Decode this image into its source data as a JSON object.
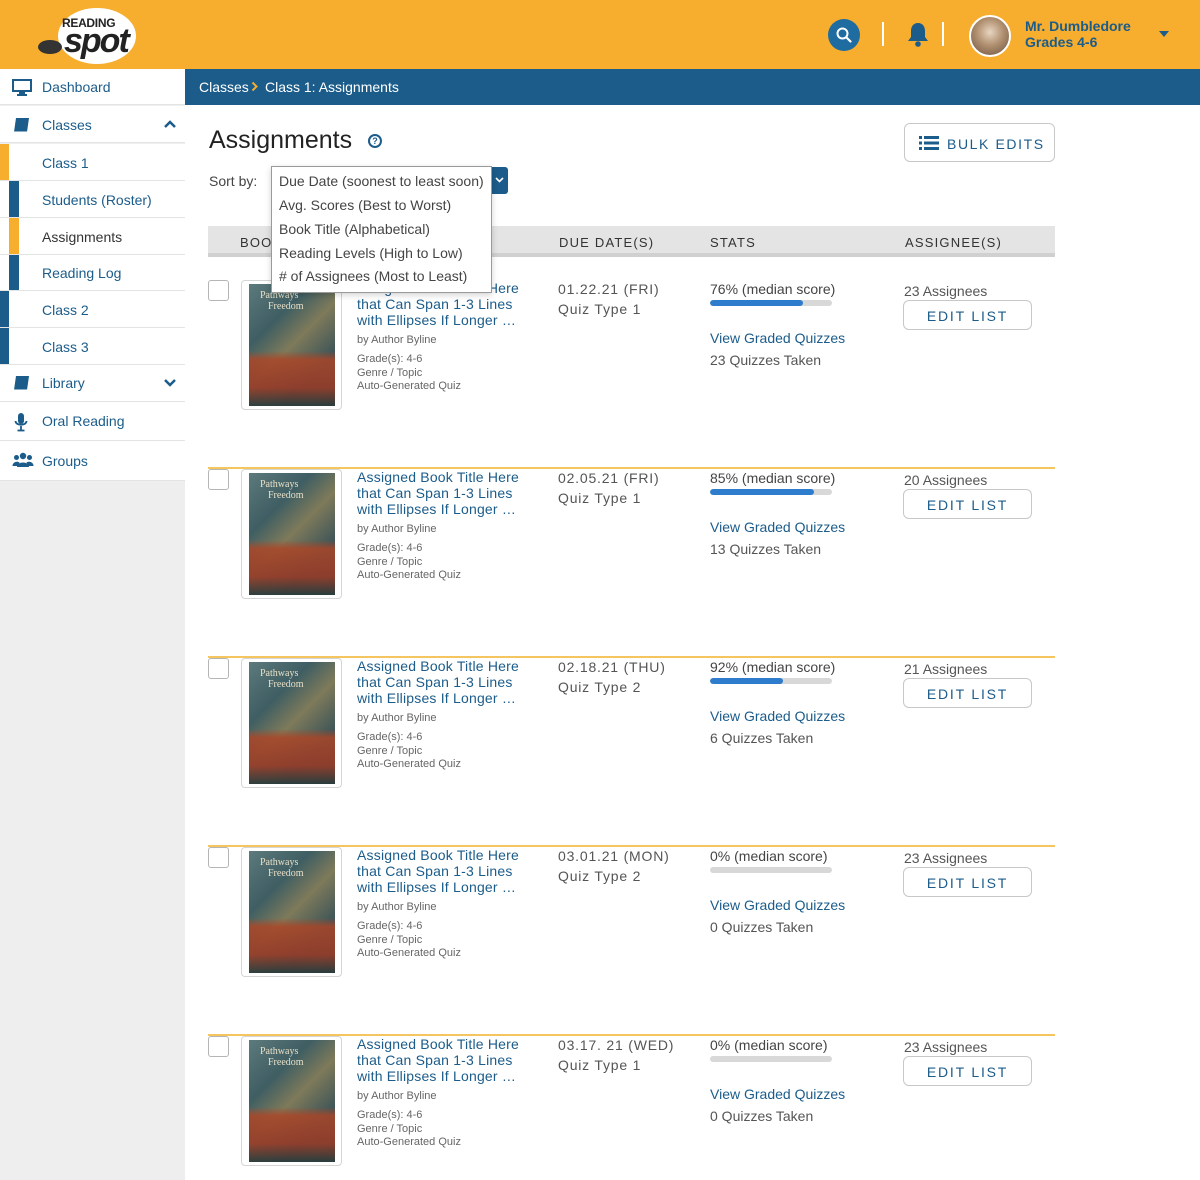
{
  "app": {
    "logo_top": "READING",
    "logo_main": "spot"
  },
  "header": {
    "user_name": "Mr. Dumbledore",
    "user_grade": "Grades 4-6"
  },
  "sidebar": {
    "items": [
      {
        "label": "Dashboard",
        "icon": "monitor-icon"
      },
      {
        "label": "Classes",
        "icon": "book-icon"
      },
      {
        "label": "Class 1"
      },
      {
        "label": "Students (Roster)"
      },
      {
        "label": "Assignments"
      },
      {
        "label": "Reading Log"
      },
      {
        "label": "Class 2"
      },
      {
        "label": "Class 3"
      },
      {
        "label": "Library",
        "icon": "book-icon"
      },
      {
        "label": "Oral Reading",
        "icon": "microphone-icon"
      },
      {
        "label": "Groups",
        "icon": "group-icon"
      }
    ]
  },
  "breadcrumb": {
    "root": "Classes",
    "current": "Class 1: Assignments"
  },
  "page": {
    "title": "Assignments",
    "help": "?",
    "bulk_edits": "BULK EDITS",
    "sort_label": "Sort by:"
  },
  "sort_options": [
    "Due Date (soonest to least soon)",
    "Avg. Scores (Best to Worst)",
    "Book Title (Alphabetical)",
    "Reading Levels (High to Low)",
    "# of Assignees (Most to Least)"
  ],
  "columns": {
    "book": "BOOK",
    "due": "DUE DATE(S)",
    "stats": "STATS",
    "assignees": "ASSIGNEE(S)"
  },
  "cover": {
    "line1": "Pathways",
    "line2": "Freedom"
  },
  "rows": [
    {
      "title": "Assigned Book Title Here that Can Span 1-3 Lines with Ellipses If Longer …",
      "byline": "by Author Byline",
      "grades": "Grade(s): 4-6",
      "genre": "Genre / Topic",
      "quiz": "Auto-Generated Quiz",
      "due": "01.22.21 (FRI)",
      "quiz_type": "Quiz Type 1",
      "median": "76% (median score)",
      "median_value": 0.76,
      "view": "View Graded Quizzes",
      "taken": "23 Quizzes Taken",
      "assignees": "23 Assignees",
      "edit": "EDIT LIST"
    },
    {
      "title": "Assigned Book Title Here that Can Span 1-3 Lines with Ellipses If Longer …",
      "byline": "by Author Byline",
      "grades": "Grade(s): 4-6",
      "genre": "Genre / Topic",
      "quiz": "Auto-Generated Quiz",
      "due": "02.05.21 (FRI)",
      "quiz_type": "Quiz Type 1",
      "median": "85% (median score)",
      "median_value": 0.85,
      "view": "View Graded Quizzes",
      "taken": "13 Quizzes Taken",
      "assignees": "20 Assignees",
      "edit": "EDIT LIST"
    },
    {
      "title": "Assigned Book Title Here that Can Span 1-3 Lines with Ellipses If Longer …",
      "byline": "by Author Byline",
      "grades": "Grade(s): 4-6",
      "genre": "Genre / Topic",
      "quiz": "Auto-Generated Quiz",
      "due": "02.18.21 (THU)",
      "quiz_type": "Quiz Type 2",
      "median": "92% (median score)",
      "median_value": 0.6,
      "view": "View Graded Quizzes",
      "taken": "6 Quizzes Taken",
      "assignees": "21 Assignees",
      "edit": "EDIT LIST"
    },
    {
      "title": "Assigned Book Title Here that Can Span 1-3 Lines with Ellipses If Longer …",
      "byline": "by Author Byline",
      "grades": "Grade(s): 4-6",
      "genre": "Genre / Topic",
      "quiz": "Auto-Generated Quiz",
      "due": "03.01.21 (MON)",
      "quiz_type": "Quiz Type 2",
      "median": "0% (median score)",
      "median_value": 0,
      "view": "View Graded Quizzes",
      "taken": "0 Quizzes Taken",
      "assignees": "23 Assignees",
      "edit": "EDIT LIST"
    },
    {
      "title": "Assigned Book Title Here that Can Span 1-3 Lines with Ellipses If Longer …",
      "byline": "by Author Byline",
      "grades": "Grade(s): 4-6",
      "genre": "Genre / Topic",
      "quiz": "Auto-Generated Quiz",
      "due": "03.17. 21 (WED)",
      "quiz_type": "Quiz Type 1",
      "median": "0% (median score)",
      "median_value": 0,
      "view": "View Graded Quizzes",
      "taken": "0 Quizzes Taken",
      "assignees": "23 Assignees",
      "edit": "EDIT LIST"
    }
  ],
  "colors": {
    "header_bg": "#F7AD2D",
    "primary": "#1B5C8A",
    "progress": "#2E7DCC",
    "row_divider": "#F5C55F"
  }
}
